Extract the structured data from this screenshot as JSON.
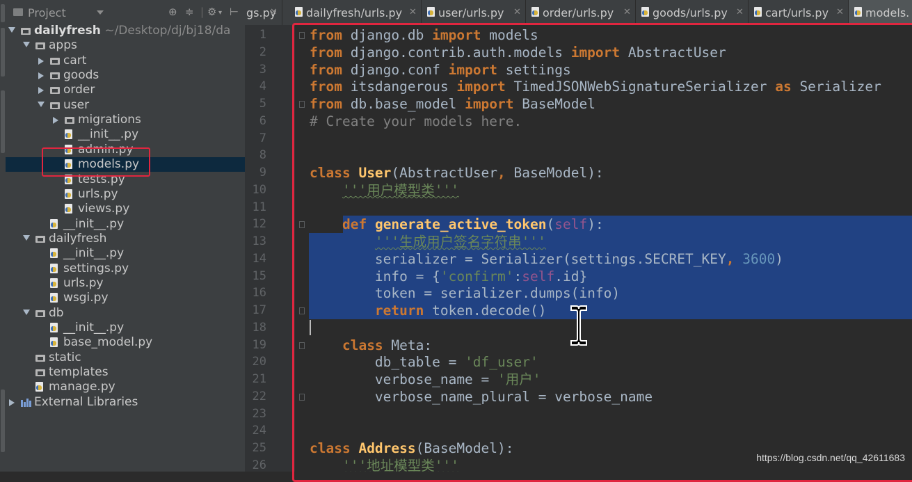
{
  "project_panel": {
    "title": "Project",
    "tree": [
      {
        "label": "dailyfresh",
        "suffix": "~/Desktop/dj/bj18/da",
        "type": "folder",
        "depth": 0,
        "expanded": true,
        "bold": true
      },
      {
        "label": "apps",
        "type": "folder",
        "depth": 1,
        "expanded": true
      },
      {
        "label": "cart",
        "type": "folder",
        "depth": 2,
        "expanded": false
      },
      {
        "label": "goods",
        "type": "folder",
        "depth": 2,
        "expanded": false
      },
      {
        "label": "order",
        "type": "folder",
        "depth": 2,
        "expanded": false
      },
      {
        "label": "user",
        "type": "folder",
        "depth": 2,
        "expanded": true
      },
      {
        "label": "migrations",
        "type": "folder",
        "depth": 3,
        "expanded": false
      },
      {
        "label": "__init__.py",
        "type": "py",
        "depth": 3
      },
      {
        "label": "admin.py",
        "type": "py",
        "depth": 3
      },
      {
        "label": "models.py",
        "type": "py",
        "depth": 3,
        "selected": true
      },
      {
        "label": "tests.py",
        "type": "py",
        "depth": 3
      },
      {
        "label": "urls.py",
        "type": "py",
        "depth": 3
      },
      {
        "label": "views.py",
        "type": "py",
        "depth": 3
      },
      {
        "label": "__init__.py",
        "type": "py",
        "depth": 2
      },
      {
        "label": "dailyfresh",
        "type": "folder",
        "depth": 1,
        "expanded": true
      },
      {
        "label": "__init__.py",
        "type": "py",
        "depth": 2
      },
      {
        "label": "settings.py",
        "type": "py",
        "depth": 2
      },
      {
        "label": "urls.py",
        "type": "py",
        "depth": 2
      },
      {
        "label": "wsgi.py",
        "type": "py",
        "depth": 2
      },
      {
        "label": "db",
        "type": "folder",
        "depth": 1,
        "expanded": true
      },
      {
        "label": "__init__.py",
        "type": "py",
        "depth": 2
      },
      {
        "label": "base_model.py",
        "type": "py",
        "depth": 2
      },
      {
        "label": "static",
        "type": "folder",
        "depth": 1,
        "leaf": true
      },
      {
        "label": "templates",
        "type": "folder",
        "depth": 1,
        "leaf": true
      },
      {
        "label": "manage.py",
        "type": "py",
        "depth": 1
      },
      {
        "label": "External Libraries",
        "type": "lib",
        "depth": 0,
        "expanded": false
      }
    ]
  },
  "tabs": [
    {
      "label": "gs.py",
      "active": false
    },
    {
      "label": "dailyfresh/urls.py",
      "active": false
    },
    {
      "label": "user/urls.py",
      "active": false
    },
    {
      "label": "order/urls.py",
      "active": false
    },
    {
      "label": "goods/urls.py",
      "active": false
    },
    {
      "label": "cart/urls.py",
      "active": false
    },
    {
      "label": "models.",
      "active": true
    }
  ],
  "editor": {
    "lines": [
      [
        [
          "kw",
          "from"
        ],
        [
          "p",
          " django.db "
        ],
        [
          "kw",
          "import"
        ],
        [
          "p",
          " models"
        ]
      ],
      [
        [
          "kw",
          "from"
        ],
        [
          "p",
          " django.contrib.auth.models "
        ],
        [
          "kw",
          "import"
        ],
        [
          "p",
          " AbstractUser"
        ]
      ],
      [
        [
          "kw",
          "from"
        ],
        [
          "p",
          " django.conf "
        ],
        [
          "kw",
          "import"
        ],
        [
          "p",
          " settings"
        ]
      ],
      [
        [
          "kw",
          "from"
        ],
        [
          "p",
          " itsdangerous "
        ],
        [
          "kw",
          "import"
        ],
        [
          "p",
          " TimedJSONWebSignatureSerializer "
        ],
        [
          "kw",
          "as"
        ],
        [
          "p",
          " Serializer"
        ]
      ],
      [
        [
          "kw",
          "from"
        ],
        [
          "p",
          " db.base_model "
        ],
        [
          "kw",
          "import"
        ],
        [
          "p",
          " BaseModel"
        ]
      ],
      [
        [
          "cm",
          "# Create your models here."
        ]
      ],
      [],
      [],
      [
        [
          "kw",
          "class"
        ],
        [
          "p",
          " "
        ],
        [
          "fn",
          "User"
        ],
        [
          "p",
          "(AbstractUser"
        ],
        [
          "kw",
          ","
        ],
        [
          "p",
          " BaseModel):"
        ]
      ],
      [
        [
          "p",
          "    "
        ],
        [
          "sq",
          "'''用户模型类'''"
        ]
      ],
      [],
      [
        [
          "p",
          "    "
        ],
        [
          "kw",
          "def"
        ],
        [
          "p",
          " "
        ],
        [
          "fn",
          "generate_active_token"
        ],
        [
          "p",
          "("
        ],
        [
          "slf",
          "self"
        ],
        [
          "p",
          "):"
        ]
      ],
      [
        [
          "p",
          "        "
        ],
        [
          "sq",
          "'''生成用户签名字符串'''"
        ]
      ],
      [
        [
          "p",
          "        serializer = Serializer(settings.SECRET_KEY"
        ],
        [
          "kw",
          ","
        ],
        [
          "p",
          " "
        ],
        [
          "num",
          "3600"
        ],
        [
          "p",
          ")"
        ]
      ],
      [
        [
          "p",
          "        info = {"
        ],
        [
          "str",
          "'confirm'"
        ],
        [
          "p",
          ":"
        ],
        [
          "slf",
          "self"
        ],
        [
          "p",
          ".id}"
        ]
      ],
      [
        [
          "p",
          "        token = serializer.dumps(info)"
        ]
      ],
      [
        [
          "p",
          "        "
        ],
        [
          "kw",
          "return"
        ],
        [
          "p",
          " token.decode()"
        ]
      ],
      [],
      [
        [
          "p",
          "    "
        ],
        [
          "kw",
          "class"
        ],
        [
          "p",
          " Meta:"
        ]
      ],
      [
        [
          "p",
          "        db_table = "
        ],
        [
          "str",
          "'df_user'"
        ]
      ],
      [
        [
          "p",
          "        verbose_name = "
        ],
        [
          "str",
          "'用户'"
        ]
      ],
      [
        [
          "p",
          "        verbose_name_plural = verbose_name"
        ]
      ],
      [],
      [],
      [
        [
          "kw",
          "class"
        ],
        [
          "p",
          " "
        ],
        [
          "fn",
          "Address"
        ],
        [
          "p",
          "(BaseModel):"
        ]
      ],
      [
        [
          "p",
          "    "
        ],
        [
          "sq",
          "'''地址模型类'''"
        ]
      ]
    ],
    "line_numbers": [
      "1",
      "2",
      "3",
      "4",
      "5",
      "6",
      "7",
      "8",
      "9",
      "10",
      "11",
      "12",
      "13",
      "14",
      "15",
      "16",
      "17",
      "18",
      "19",
      "20",
      "21",
      "22",
      "23",
      "24",
      "25",
      "26"
    ]
  },
  "watermark": "https://blog.csdn.net/qq_42611683",
  "colors": {
    "keyword": "#cc7832",
    "function": "#ffc66d",
    "string": "#6a8759",
    "number": "#6897bb",
    "comment": "#808080",
    "self": "#94558d",
    "selection": "#214283",
    "annotation_box": "#e0263f"
  }
}
